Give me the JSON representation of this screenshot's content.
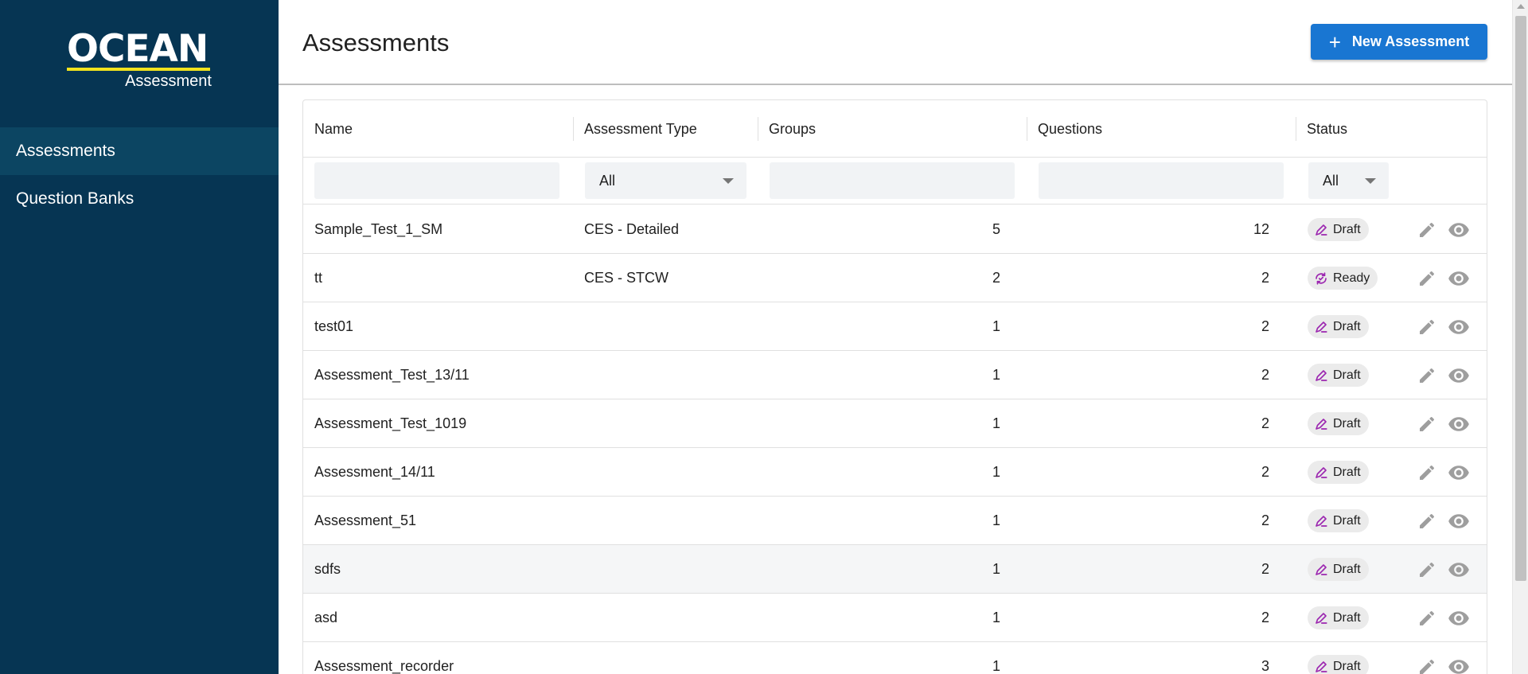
{
  "app": {
    "logo_main": "OCEAN",
    "logo_sub": "Assessment"
  },
  "sidebar": {
    "items": [
      {
        "label": "Assessments",
        "active": true
      },
      {
        "label": "Question Banks",
        "active": false
      }
    ]
  },
  "header": {
    "title": "Assessments",
    "new_button_label": "New Assessment",
    "new_button_icon": "plus-icon"
  },
  "colors": {
    "sidebar_bg": "#063553",
    "sidebar_active": "#0c4562",
    "logo_accent": "#f3e31d",
    "primary": "#1976d2",
    "status_icon": "#9c27b0",
    "action_icon": "#9e9e9e"
  },
  "table": {
    "columns": [
      "Name",
      "Assessment Type",
      "Groups",
      "Questions",
      "Status"
    ],
    "filters": {
      "type_selected": "All",
      "status_selected": "All"
    },
    "rows": [
      {
        "name": "Sample_Test_1_SM",
        "type": "CES - Detailed",
        "groups": "5",
        "questions": "12",
        "status": "Draft",
        "status_icon": "draft-edit-icon"
      },
      {
        "name": "tt",
        "type": "CES - STCW",
        "groups": "2",
        "questions": "2",
        "status": "Ready",
        "status_icon": "ready-refresh-icon"
      },
      {
        "name": "test01",
        "type": "",
        "groups": "1",
        "questions": "2",
        "status": "Draft",
        "status_icon": "draft-edit-icon"
      },
      {
        "name": "Assessment_Test_13/11",
        "type": "",
        "groups": "1",
        "questions": "2",
        "status": "Draft",
        "status_icon": "draft-edit-icon"
      },
      {
        "name": "Assessment_Test_1019",
        "type": "",
        "groups": "1",
        "questions": "2",
        "status": "Draft",
        "status_icon": "draft-edit-icon"
      },
      {
        "name": "Assessment_14/11",
        "type": "",
        "groups": "1",
        "questions": "2",
        "status": "Draft",
        "status_icon": "draft-edit-icon"
      },
      {
        "name": "Assessment_51",
        "type": "",
        "groups": "1",
        "questions": "2",
        "status": "Draft",
        "status_icon": "draft-edit-icon"
      },
      {
        "name": "sdfs",
        "type": "",
        "groups": "1",
        "questions": "2",
        "status": "Draft",
        "status_icon": "draft-edit-icon"
      },
      {
        "name": "asd",
        "type": "",
        "groups": "1",
        "questions": "2",
        "status": "Draft",
        "status_icon": "draft-edit-icon"
      },
      {
        "name": "Assessment_recorder",
        "type": "",
        "groups": "1",
        "questions": "3",
        "status": "Draft",
        "status_icon": "draft-edit-icon"
      }
    ],
    "row_actions": [
      "edit-icon",
      "view-icon"
    ]
  }
}
